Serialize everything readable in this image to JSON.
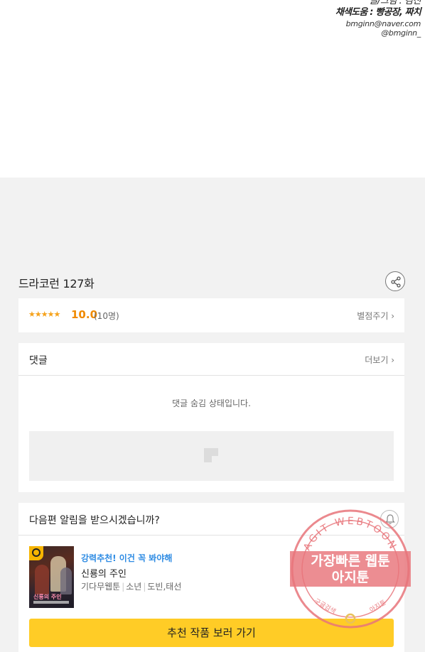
{
  "credits": {
    "line1": "글/그림 : 김진",
    "line2": "채색도움 : 빵공장, 짜치",
    "email": "bmginn@naver.com",
    "handle": "@bmginn_"
  },
  "episode": {
    "title": "드라코런 127화",
    "share_icon": "share-icon"
  },
  "rating": {
    "stars": "★★★★★",
    "score": "10.0",
    "count": "(10명)",
    "rate_button": "별점주기 ›"
  },
  "comments": {
    "title": "댓글",
    "more": "더보기 ›",
    "hidden_message": "댓글 숨김 상태입니다."
  },
  "notify": {
    "title": "다음편 알림을 받으시겠습니까?",
    "bell_icon": "bell-icon"
  },
  "recommendation": {
    "tag": "강력추천! 이건 꼭 봐야해",
    "name": "신룡의 주인",
    "meta": [
      "기다무웹툰",
      "소년",
      "도빈,태선"
    ],
    "thumb_title": "신룡의 주인",
    "button": "추천 작품 보러 가기"
  },
  "watermark": {
    "ring_text": "AGIT WEBTOON",
    "line1": "가장빠른 웹툰",
    "line2": "아지툰",
    "bottom_left": "구글검색",
    "bottom_right": "아지툰"
  },
  "colors": {
    "accent_yellow": "#ffcc26",
    "star_orange": "#f5a21b",
    "link_blue": "#2d8be3",
    "watermark_red": "#e8747a"
  }
}
